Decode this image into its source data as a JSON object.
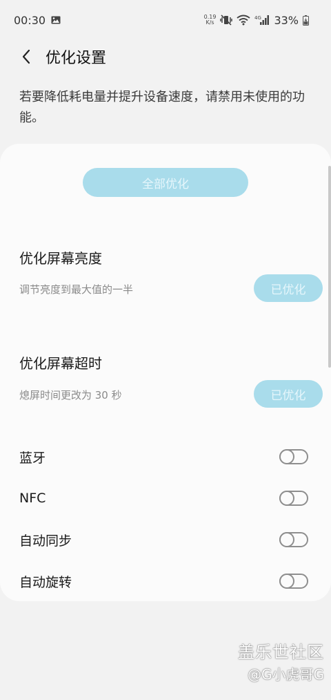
{
  "status_bar": {
    "time": "00:30",
    "net_speed_value": "0.19",
    "net_speed_unit": "K/s",
    "network_type": "4G",
    "battery": "33%",
    "icons": [
      "image-icon",
      "mute-vibrate-icon",
      "wifi-icon",
      "signal-icon",
      "battery-charging-icon"
    ]
  },
  "header": {
    "back_icon": "back-arrow-icon",
    "title": "优化设置"
  },
  "description": "若要降低耗电量并提升设备速度，请禁用未使用的功能。",
  "optimize_all_label": "全部优化",
  "optimizations": [
    {
      "title": "优化屏幕亮度",
      "subtitle": "调节亮度到最大值的一半",
      "button": "已优化"
    },
    {
      "title": "优化屏幕超时",
      "subtitle": "熄屏时间更改为 30 秒",
      "button": "已优化"
    }
  ],
  "toggles": [
    {
      "label": "蓝牙",
      "on": false
    },
    {
      "label": "NFC",
      "on": false
    },
    {
      "label": "自动同步",
      "on": false
    },
    {
      "label": "自动旋转",
      "on": false
    }
  ],
  "watermark": {
    "line1": "盖乐世社区",
    "line2": "@G小虎哥G"
  },
  "colors": {
    "accent_button": "#a9dceb",
    "accent_button_text": "#e6f6fb",
    "background": "#f2f2f2",
    "card": "#fbfbfb"
  }
}
